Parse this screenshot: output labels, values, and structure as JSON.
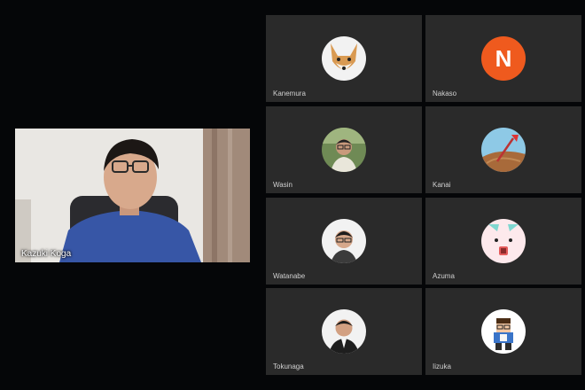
{
  "speaker": {
    "name": "Kazuki Koga"
  },
  "participants": [
    {
      "name": "Kanemura",
      "avatar": "fox-icon"
    },
    {
      "name": "Nakaso",
      "avatar": "letter-avatar",
      "initial": "N",
      "color": "#ef5a1e"
    },
    {
      "name": "Wasin",
      "avatar": "photo-avatar"
    },
    {
      "name": "Kanai",
      "avatar": "shovel-icon"
    },
    {
      "name": "Watanabe",
      "avatar": "photo-avatar"
    },
    {
      "name": "Azuma",
      "avatar": "character-icon"
    },
    {
      "name": "Tokunaga",
      "avatar": "photo-avatar"
    },
    {
      "name": "Iizuka",
      "avatar": "pixel-character-icon"
    }
  ]
}
